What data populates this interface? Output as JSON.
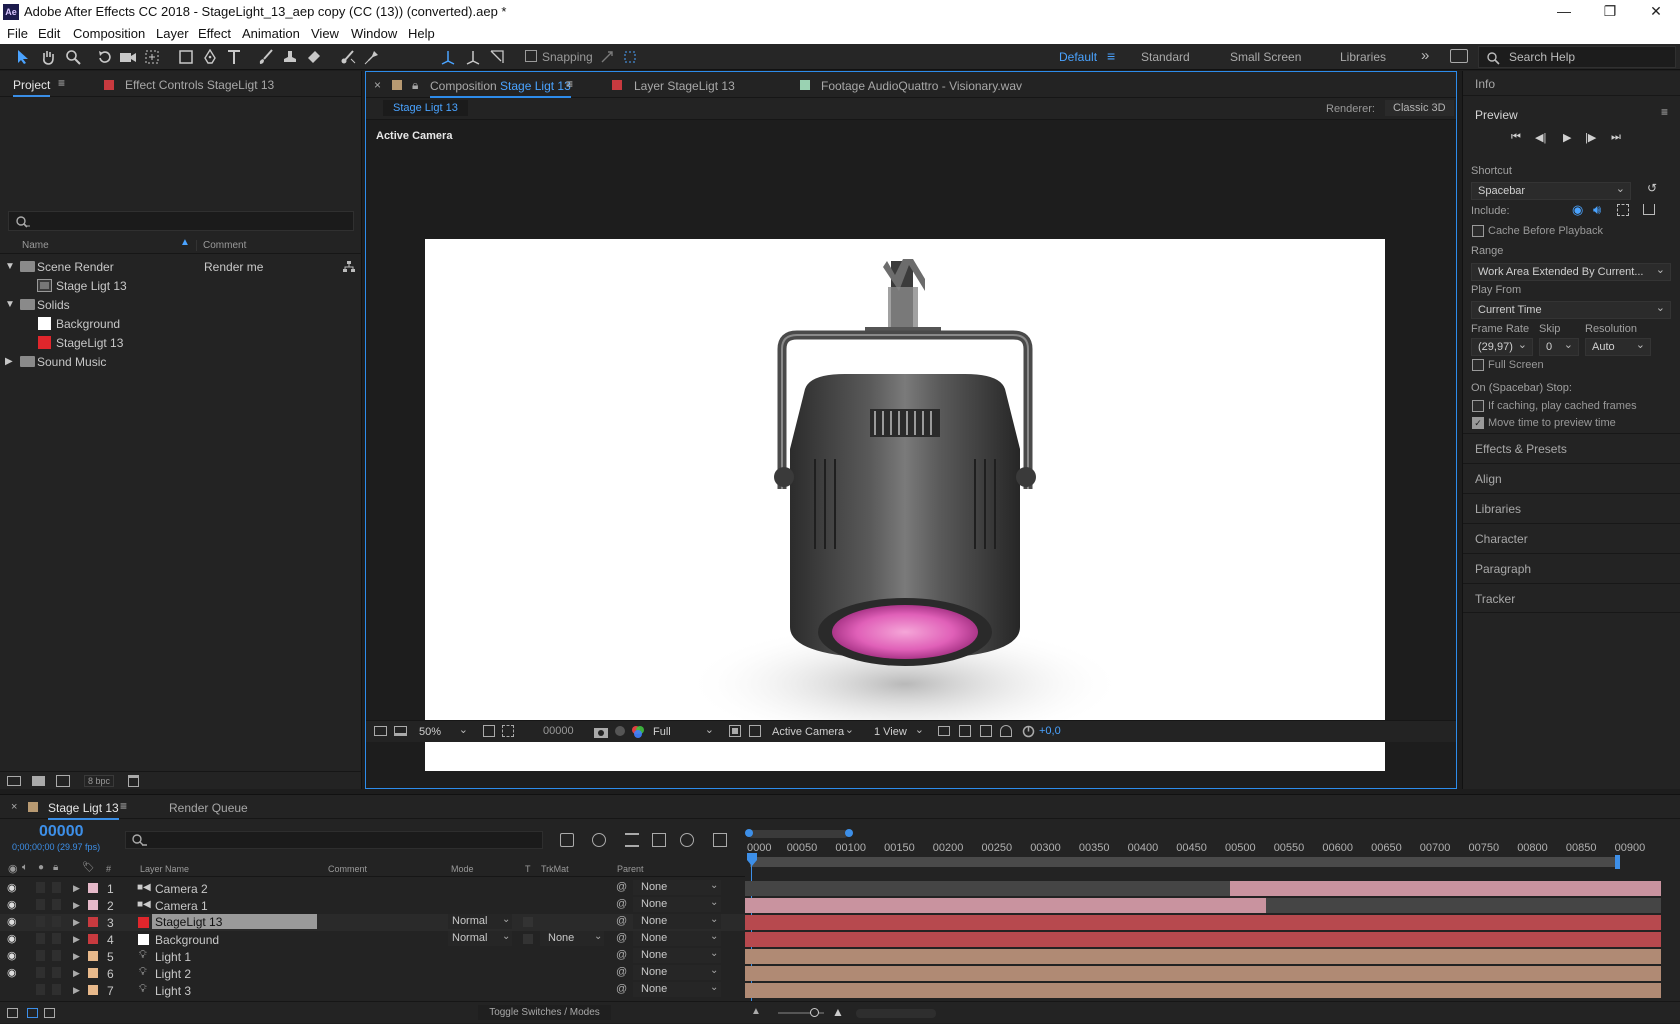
{
  "app": {
    "title": "Adobe After Effects CC 2018 - StageLight_13_aep copy (CC (13)) (converted).aep *",
    "logo": "Ae",
    "window_buttons": [
      "minimize-icon",
      "restore-icon",
      "close-icon"
    ]
  },
  "menu": [
    "File",
    "Edit",
    "Composition",
    "Layer",
    "Effect",
    "Animation",
    "View",
    "Window",
    "Help"
  ],
  "toolbar": {
    "snapping_label": "Snapping",
    "workspaces": [
      "Default",
      "Standard",
      "Small Screen",
      "Libraries"
    ],
    "active_workspace": "Default",
    "search_placeholder": "Search Help"
  },
  "project": {
    "tab_project": "Project",
    "tab_effects": "Effect Controls StageLigt 13",
    "columns": {
      "name": "Name",
      "comment": "Comment"
    },
    "items": [
      {
        "label": "Scene Render",
        "comment": "Render me",
        "kind": "folder"
      },
      {
        "label": "Stage Ligt 13",
        "comment": "",
        "kind": "comp"
      },
      {
        "label": "Solids",
        "comment": "",
        "kind": "folder"
      },
      {
        "label": "Background",
        "comment": "",
        "kind": "solid-white"
      },
      {
        "label": "StageLigt 13",
        "comment": "",
        "kind": "solid-red"
      },
      {
        "label": "Sound Music",
        "comment": "",
        "kind": "folder"
      }
    ],
    "bpc": "8 bpc"
  },
  "viewer": {
    "tab_comp_prefix": "Composition",
    "tab_comp_name": "Stage Ligt 13",
    "tab_layer": "Layer StageLigt 13",
    "tab_footage": "Footage AudioQuattro - Visionary.wav",
    "comp_chip": "Stage Ligt 13",
    "renderer_label": "Renderer:",
    "renderer_value": "Classic 3D",
    "camera_label": "Active Camera",
    "bottom": {
      "zoom": "50%",
      "timecode": "00000",
      "resolution": "Full",
      "camera": "Active Camera",
      "views": "1 View",
      "exposure": "+0,0"
    },
    "colors": {
      "accent": "#2d8ceb",
      "lens": "#e060b8"
    }
  },
  "right": {
    "info": "Info",
    "preview": "Preview",
    "shortcut_label": "Shortcut",
    "shortcut_value": "Spacebar",
    "include_label": "Include:",
    "cache_label": "Cache Before Playback",
    "range_label": "Range",
    "range_value": "Work Area Extended By Current...",
    "play_from_label": "Play From",
    "play_from_value": "Current Time",
    "frame_rate_label": "Frame Rate",
    "skip_label": "Skip",
    "resolution_label": "Resolution",
    "frame_rate_value": "(29,97)",
    "skip_value": "0",
    "resolution_value": "Auto",
    "full_screen_label": "Full Screen",
    "stop_label": "On (Spacebar) Stop:",
    "if_caching_label": "If caching, play cached frames",
    "move_time_label": "Move time to preview time",
    "sections": [
      "Effects & Presets",
      "Align",
      "Libraries",
      "Character",
      "Paragraph",
      "Tracker"
    ]
  },
  "timeline": {
    "tab_comp": "Stage Ligt 13",
    "tab_render": "Render Queue",
    "timecode": "00000",
    "timecode_sub": "0;00;00;00 (29.97 fps)",
    "columns": {
      "hash": "#",
      "layer_name": "Layer Name",
      "comment": "Comment",
      "mode": "Mode",
      "t": "T",
      "trkmat": "TrkMat",
      "parent": "Parent"
    },
    "ruler": [
      "0000",
      "00050",
      "00100",
      "00150",
      "00200",
      "00250",
      "00300",
      "00350",
      "00400",
      "00450",
      "00500",
      "00550",
      "00600",
      "00650",
      "00700",
      "00750",
      "00800",
      "00850",
      "00900"
    ],
    "layers": [
      {
        "num": "1",
        "name": "Camera 2",
        "type": "camera",
        "label_color": "#e5b9c9",
        "mode": "",
        "trkmat": "",
        "parent": "None",
        "visible": true
      },
      {
        "num": "2",
        "name": "Camera 1",
        "type": "camera",
        "label_color": "#e5b9c9",
        "mode": "",
        "trkmat": "",
        "parent": "None",
        "visible": true
      },
      {
        "num": "3",
        "name": "StageLigt 13",
        "type": "solid-red",
        "label_color": "#c83a3f",
        "mode": "Normal",
        "trkmat": "",
        "parent": "None",
        "visible": true
      },
      {
        "num": "4",
        "name": "Background",
        "type": "solid-white",
        "label_color": "#c83a3f",
        "mode": "Normal",
        "trkmat": "None",
        "parent": "None",
        "visible": true
      },
      {
        "num": "5",
        "name": "Light 1",
        "type": "light",
        "label_color": "#e8b98b",
        "mode": "",
        "trkmat": "",
        "parent": "None",
        "visible": true
      },
      {
        "num": "6",
        "name": "Light 2",
        "type": "light",
        "label_color": "#e8b98b",
        "mode": "",
        "trkmat": "",
        "parent": "None",
        "visible": true
      },
      {
        "num": "7",
        "name": "Light 3",
        "type": "light",
        "label_color": "#e8b98b",
        "mode": "",
        "trkmat": "",
        "parent": "None",
        "visible": false
      }
    ],
    "toggle_label": "Toggle Switches / Modes"
  }
}
